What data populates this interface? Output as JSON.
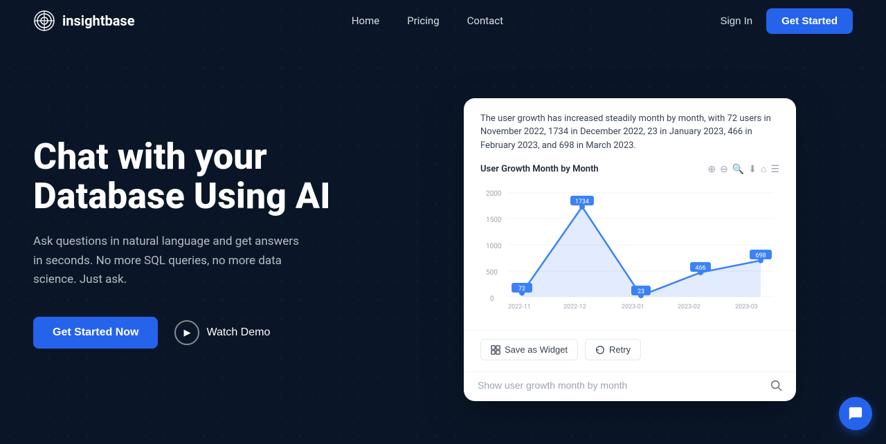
{
  "brand": {
    "name": "insightbase",
    "logo_alt": "insightbase logo"
  },
  "nav": {
    "links": [
      {
        "label": "Home",
        "id": "home"
      },
      {
        "label": "Pricing",
        "id": "pricing"
      },
      {
        "label": "Contact",
        "id": "contact"
      }
    ],
    "sign_in": "Sign In",
    "get_started": "Get Started"
  },
  "hero": {
    "title": "Chat with your Database Using AI",
    "subtitle": "Ask questions in natural language and get answers in seconds. No more SQL queries, no more data science. Just ask.",
    "cta_primary": "Get Started Now",
    "cta_demo": "Watch Demo"
  },
  "chart": {
    "analysis": "The user growth has increased steadily month by month, with 72 users in November 2022, 1734 in December 2022, 23 in January 2023, 466 in February 2023, and 698 in March 2023.",
    "title": "User Growth Month by Month",
    "data": [
      {
        "month": "2022-11",
        "value": 72
      },
      {
        "month": "2022-12",
        "value": 1734
      },
      {
        "month": "2023-01",
        "value": 23
      },
      {
        "month": "2023-02",
        "value": 466
      },
      {
        "month": "2023-03",
        "value": 698
      }
    ],
    "y_ticks": [
      0,
      500,
      1000,
      1500,
      2000
    ],
    "actions": {
      "save_widget": "Save as Widget",
      "retry": "Retry"
    }
  },
  "chat_input": {
    "placeholder": "Show user growth month by month"
  },
  "colors": {
    "primary_blue": "#2563eb",
    "line_blue": "#3b82f6",
    "area_fill": "rgba(59,130,246,0.15)",
    "bg_dark": "#0a1628"
  }
}
